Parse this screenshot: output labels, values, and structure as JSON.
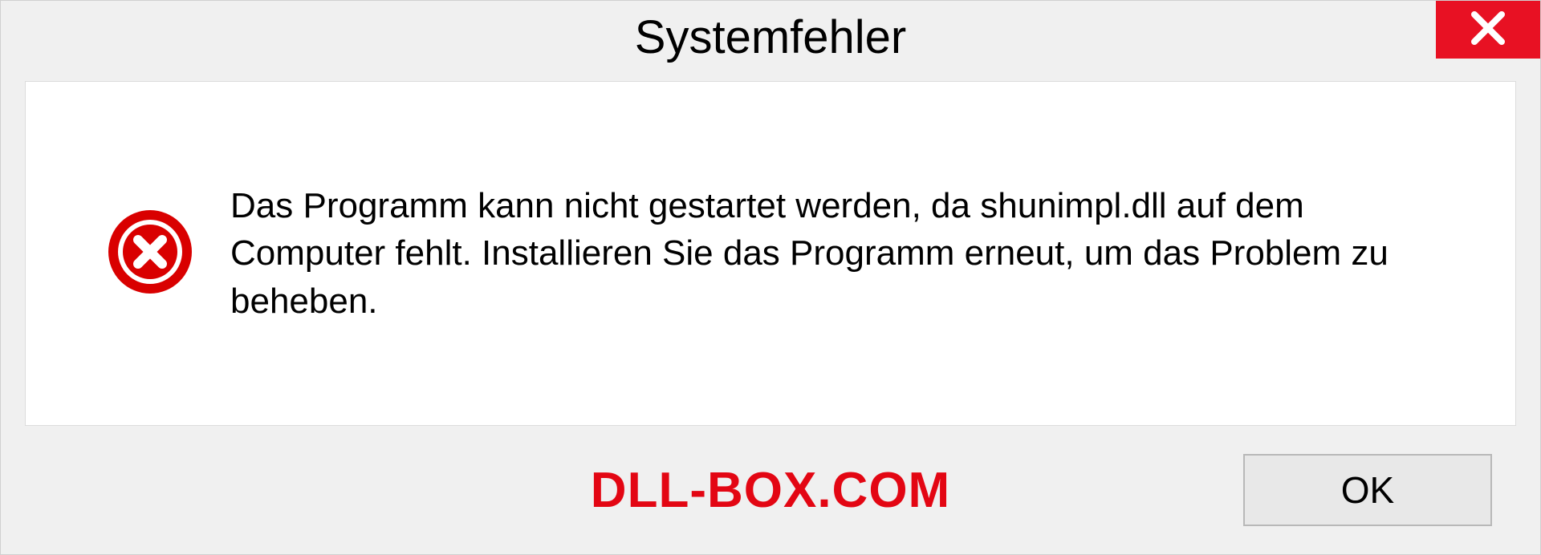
{
  "dialog": {
    "title": "Systemfehler",
    "message": "Das Programm kann nicht gestartet werden, da shunimpl.dll auf dem Computer fehlt. Installieren Sie das Programm erneut, um das Problem zu beheben.",
    "ok_label": "OK"
  },
  "watermark": "DLL-BOX.COM",
  "colors": {
    "close_button": "#e81123",
    "error_icon": "#d90000",
    "watermark": "#e30613"
  }
}
